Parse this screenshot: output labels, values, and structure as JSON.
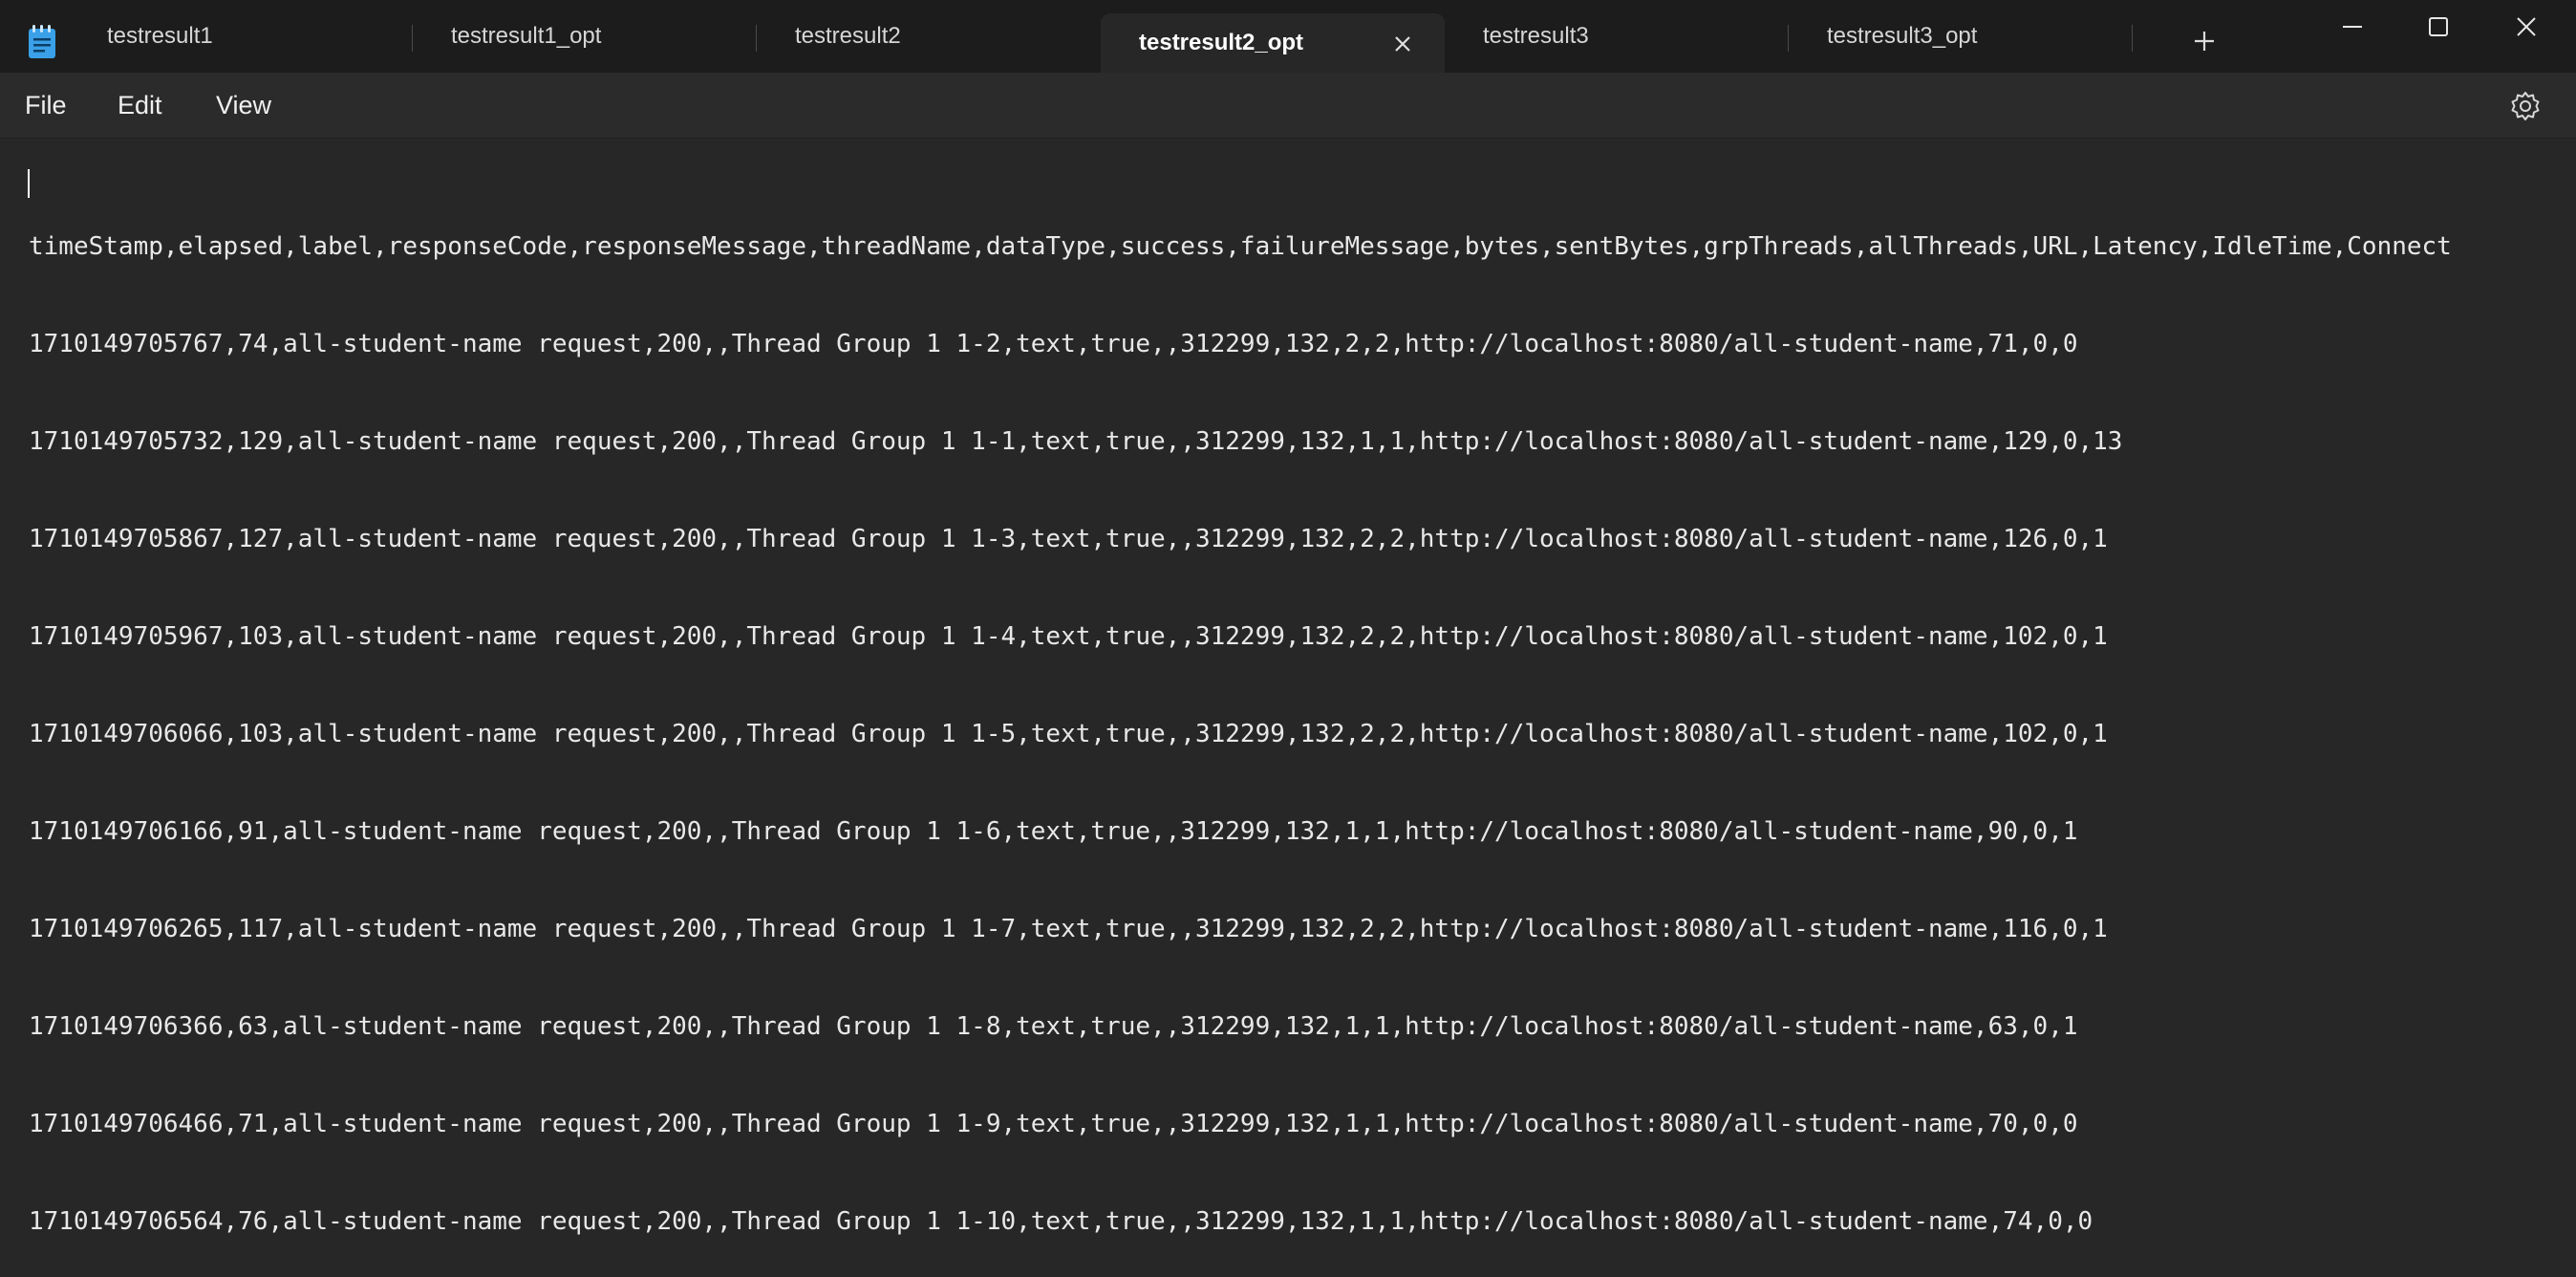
{
  "tabs": [
    {
      "label": "testresult1"
    },
    {
      "label": "testresult1_opt"
    },
    {
      "label": "testresult2"
    },
    {
      "label": "testresult2_opt"
    },
    {
      "label": "testresult3"
    },
    {
      "label": "testresult3_opt"
    }
  ],
  "active_tab": "testresult2_opt",
  "menu": {
    "file": "File",
    "edit": "Edit",
    "view": "View"
  },
  "icons": {
    "app": "notepad-icon",
    "close_tab": "close-icon",
    "new_tab": "plus-icon",
    "minimize": "minimize-icon",
    "maximize": "maximize-icon",
    "close_window": "close-icon",
    "settings": "gear-icon"
  },
  "colors": {
    "titlebar": "#1c1c1c",
    "editor": "#272727",
    "app_icon": "#3aa0e8"
  },
  "editor": {
    "lines": [
      "timeStamp,elapsed,label,responseCode,responseMessage,threadName,dataType,success,failureMessage,bytes,sentBytes,grpThreads,allThreads,URL,Latency,IdleTime,Connect",
      "1710149705767,74,all-student-name request,200,,Thread Group 1 1-2,text,true,,312299,132,2,2,http://localhost:8080/all-student-name,71,0,0",
      "1710149705732,129,all-student-name request,200,,Thread Group 1 1-1,text,true,,312299,132,1,1,http://localhost:8080/all-student-name,129,0,13",
      "1710149705867,127,all-student-name request,200,,Thread Group 1 1-3,text,true,,312299,132,2,2,http://localhost:8080/all-student-name,126,0,1",
      "1710149705967,103,all-student-name request,200,,Thread Group 1 1-4,text,true,,312299,132,2,2,http://localhost:8080/all-student-name,102,0,1",
      "1710149706066,103,all-student-name request,200,,Thread Group 1 1-5,text,true,,312299,132,2,2,http://localhost:8080/all-student-name,102,0,1",
      "1710149706166,91,all-student-name request,200,,Thread Group 1 1-6,text,true,,312299,132,1,1,http://localhost:8080/all-student-name,90,0,1",
      "1710149706265,117,all-student-name request,200,,Thread Group 1 1-7,text,true,,312299,132,2,2,http://localhost:8080/all-student-name,116,0,1",
      "1710149706366,63,all-student-name request,200,,Thread Group 1 1-8,text,true,,312299,132,1,1,http://localhost:8080/all-student-name,63,0,1",
      "1710149706466,71,all-student-name request,200,,Thread Group 1 1-9,text,true,,312299,132,1,1,http://localhost:8080/all-student-name,70,0,0",
      "1710149706564,76,all-student-name request,200,,Thread Group 1 1-10,text,true,,312299,132,1,1,http://localhost:8080/all-student-name,74,0,0"
    ]
  }
}
